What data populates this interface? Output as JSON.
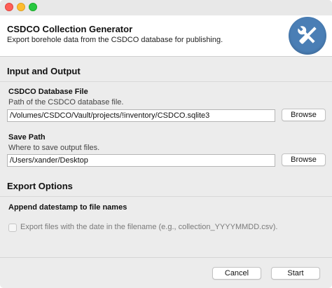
{
  "header": {
    "title": "CSDCO Collection Generator",
    "subtitle": "Export borehole data from the CSDCO database for publishing.",
    "icon": "tools-icon",
    "icon_color": "#4a7eb5"
  },
  "io_section": {
    "title": "Input and Output",
    "database": {
      "label": "CSDCO Database File",
      "help": "Path of the CSDCO database file.",
      "value": "/Volumes/CSDCO/Vault/projects/!inventory/CSDCO.sqlite3",
      "browse_label": "Browse"
    },
    "save": {
      "label": "Save Path",
      "help": "Where to save output files.",
      "value": "/Users/xander/Desktop",
      "browse_label": "Browse"
    }
  },
  "export_section": {
    "title": "Export Options",
    "datestamp": {
      "label": "Append datestamp to file names",
      "checkbox_label": "Export files with the date in the filename (e.g., collection_YYYYMMDD.csv).",
      "checked": false
    }
  },
  "footer": {
    "cancel_label": "Cancel",
    "start_label": "Start"
  }
}
